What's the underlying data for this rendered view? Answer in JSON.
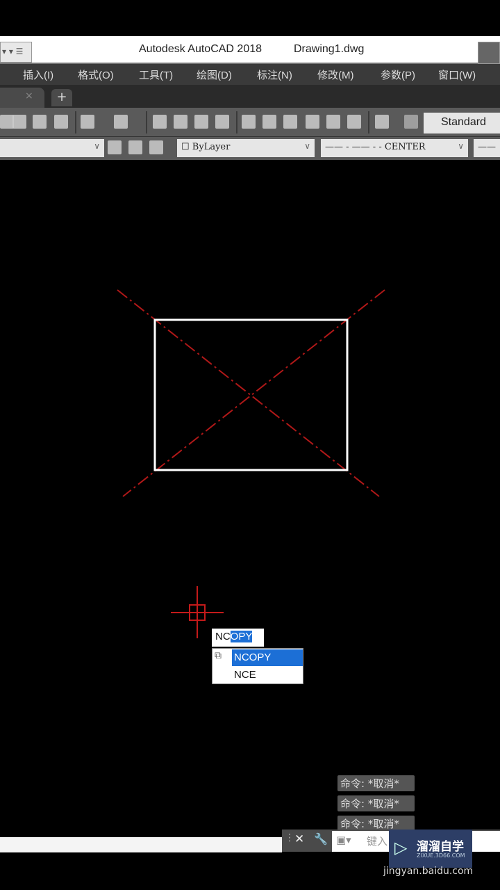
{
  "window": {
    "app_title": "Autodesk AutoCAD 2018",
    "file_name": "Drawing1.dwg"
  },
  "menu": [
    "插入(I)",
    "格式(O)",
    "工具(T)",
    "绘图(D)",
    "标注(N)",
    "修改(M)",
    "参数(P)",
    "窗口(W)"
  ],
  "tabs": {
    "close": "×",
    "new": "+"
  },
  "toolbar": {
    "text_style": "Standard"
  },
  "properties": {
    "color": "ByLayer",
    "linetype": "—— - —— - - CENTER"
  },
  "command_input": {
    "typed": "NC",
    "completion": "OPY",
    "suggestions": [
      "NCOPY",
      "NCE"
    ],
    "placeholder": "键入"
  },
  "command_history": [
    "命令: *取消*",
    "命令: *取消*",
    "命令: *取消*"
  ],
  "watermark": {
    "name": "溜溜自学",
    "url": "ZIXUE.3D66.COM",
    "source": "jingyan.baidu.com"
  },
  "colors": {
    "canvas": "#000000",
    "geometry": "#ffffff",
    "centerline": "#b01818",
    "highlight": "#1c6fd6"
  }
}
